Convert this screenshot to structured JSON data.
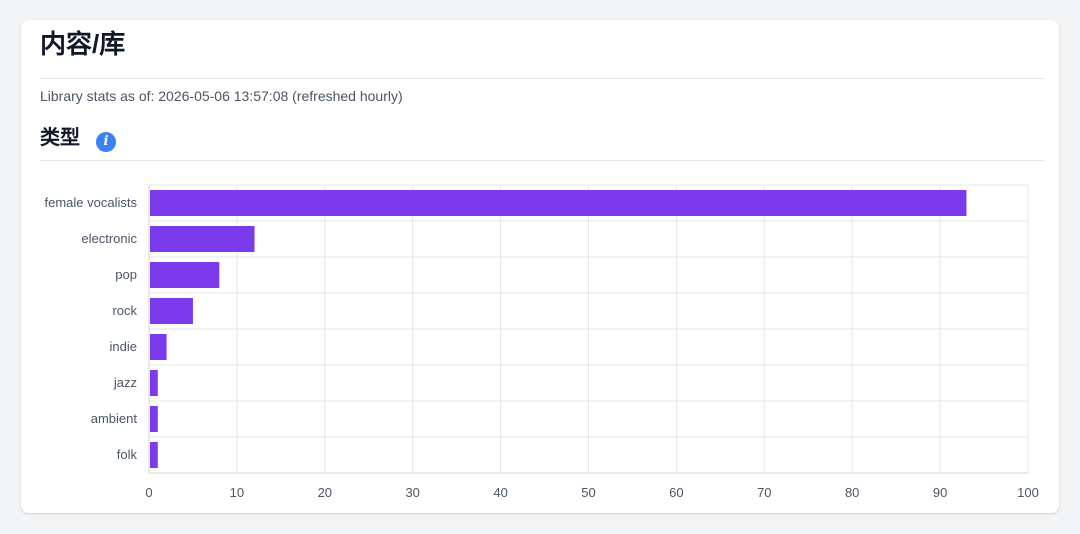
{
  "page": {
    "title": "内容/库",
    "stats_line": "Library stats as of: 2026-05-06 13:57:08 (refreshed hourly)"
  },
  "section": {
    "title": "类型",
    "info_icon": "info-icon"
  },
  "colors": {
    "bar": "#7c3aed",
    "info": "#3b82f6"
  },
  "chart_data": {
    "type": "bar",
    "orientation": "horizontal",
    "categories": [
      "female vocalists",
      "electronic",
      "pop",
      "rock",
      "indie",
      "jazz",
      "ambient",
      "folk"
    ],
    "values": [
      93,
      12,
      8,
      5,
      2,
      1,
      1,
      1
    ],
    "xlim": [
      0,
      100
    ],
    "xticks": [
      0,
      10,
      20,
      30,
      40,
      50,
      60,
      70,
      80,
      90,
      100
    ],
    "grid": true
  }
}
